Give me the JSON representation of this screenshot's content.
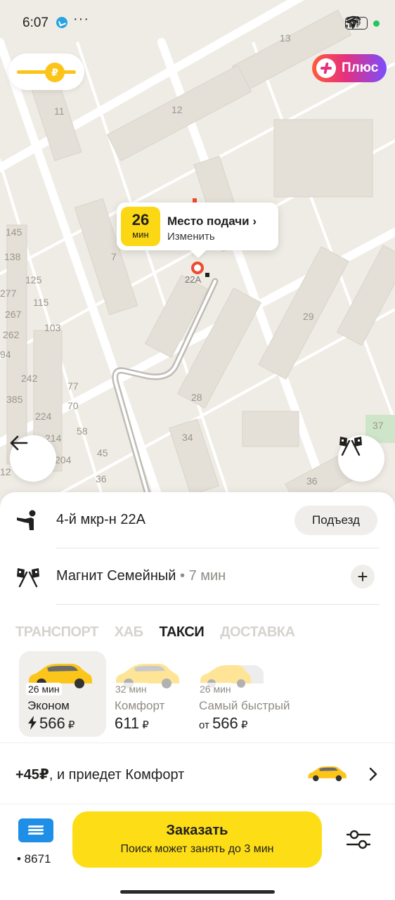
{
  "status_bar": {
    "time": "6:07",
    "dots": "···",
    "battery": "99"
  },
  "map": {
    "house_numbers": [
      "13",
      "11",
      "12",
      "7",
      "145",
      "138",
      "125",
      "115",
      "277",
      "267",
      "262",
      "103",
      "94",
      "242",
      "385",
      "224",
      "214",
      "204",
      "77",
      "70",
      "58",
      "45",
      "36",
      "12",
      "29",
      "28",
      "34",
      "36",
      "37",
      "22А"
    ],
    "plus_label": "Плюс",
    "balance_symbol": "₽"
  },
  "pickup": {
    "eta_value": "26",
    "eta_unit": "мин",
    "title": "Место подачи ›",
    "change": "Изменить",
    "pin_label": "22А"
  },
  "route": {
    "from": "4-й мкр-н 22А",
    "entrance_label": "Подъезд",
    "to": "Магнит Семейный",
    "to_eta": " • 7 мин",
    "add_label": "+"
  },
  "tabs": [
    {
      "label": "ТРАНСПОРТ",
      "active": false
    },
    {
      "label": "ХАБ",
      "active": false
    },
    {
      "label": "ТАКСИ",
      "active": true
    },
    {
      "label": "ДОСТАВКА",
      "active": false
    }
  ],
  "tariffs": [
    {
      "eta": "26 мин",
      "name": "Эконом",
      "prefix": "",
      "price": "566",
      "currency": " ₽",
      "selected": true
    },
    {
      "eta": "32 мин",
      "name": "Комфорт",
      "prefix": "",
      "price": "611",
      "currency": " ₽",
      "selected": false
    },
    {
      "eta": "26 мин",
      "name": "Самый быстрый",
      "prefix": "от ",
      "price": "566",
      "currency": " ₽",
      "selected": false
    }
  ],
  "upsell": {
    "amount": "+45₽",
    "text": ", и приедет Комфорт"
  },
  "payment": {
    "card_number": "• 8671"
  },
  "order": {
    "title": "Заказать",
    "subtitle": "Поиск может занять до 3 мин"
  },
  "colors": {
    "accent_yellow": "#fcdd16",
    "badge_yellow": "#fcd713",
    "pin_red": "#ef4a2f",
    "card_blue": "#1f8ee6"
  }
}
